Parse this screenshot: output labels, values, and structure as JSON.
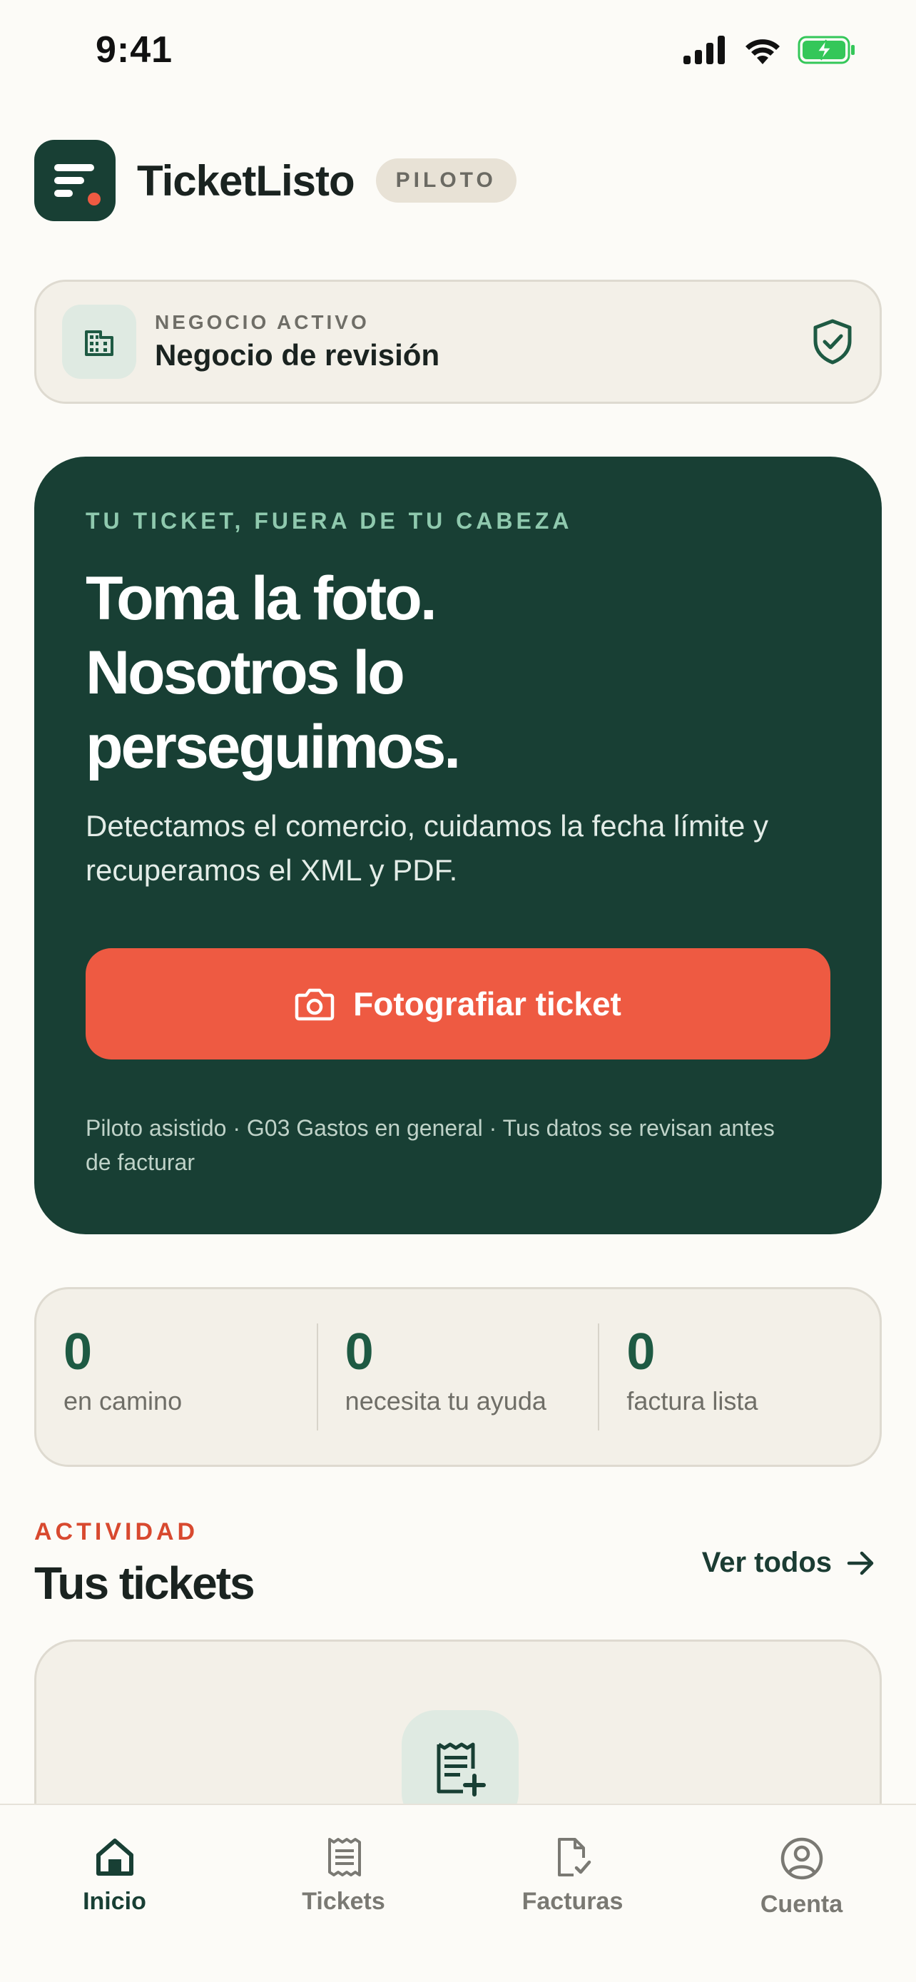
{
  "status_bar": {
    "time": "9:41"
  },
  "header": {
    "app_name": "TicketListo",
    "badge": "PILOTO"
  },
  "business": {
    "label": "NEGOCIO ACTIVO",
    "name": "Negocio de revisión"
  },
  "hero": {
    "eyebrow": "TU TICKET, FUERA DE TU CABEZA",
    "title_line1": "Toma la foto.",
    "title_line2": "Nosotros lo",
    "title_line3": "perseguimos.",
    "subtitle": "Detectamos el comercio, cuidamos la fecha límite y recuperamos el XML y PDF.",
    "button_label": "Fotografiar ticket",
    "footnote": "Piloto asistido · G03 Gastos en general · Tus datos se revisan antes de facturar"
  },
  "stats": [
    {
      "value": "0",
      "label": "en camino"
    },
    {
      "value": "0",
      "label": "necesita tu ayuda"
    },
    {
      "value": "0",
      "label": "factura lista"
    }
  ],
  "activity": {
    "eyebrow": "ACTIVIDAD",
    "title": "Tus tickets",
    "see_all": "Ver todos"
  },
  "tabs": [
    {
      "label": "Inicio",
      "icon": "home-icon",
      "active": true
    },
    {
      "label": "Tickets",
      "icon": "receipt-icon",
      "active": false
    },
    {
      "label": "Facturas",
      "icon": "invoice-check-icon",
      "active": false
    },
    {
      "label": "Cuenta",
      "icon": "account-icon",
      "active": false
    }
  ],
  "colors": {
    "background": "#FCFBF7",
    "brand_dark_green": "#183F34",
    "accent_coral": "#EE5A42",
    "eyebrow_mint": "#8FC9AE",
    "activity_red": "#D8492F",
    "battery_green": "#34C759"
  }
}
